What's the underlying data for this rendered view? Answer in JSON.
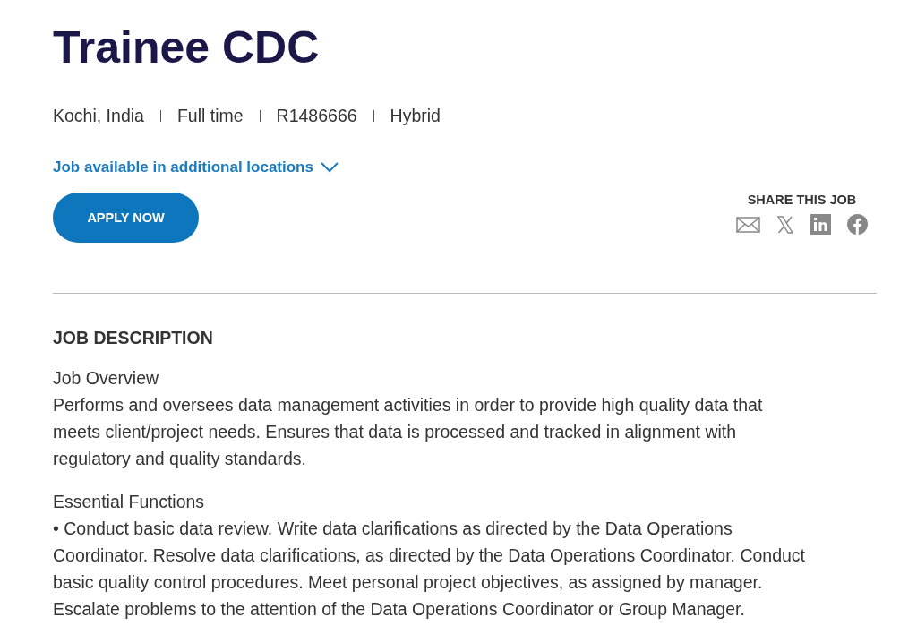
{
  "job": {
    "title": "Trainee CDC",
    "meta": [
      "Kochi, India",
      "Full time",
      "R1486666",
      "Hybrid"
    ],
    "locations_link": {
      "label": "Job available in additional locations",
      "expanded": false
    },
    "apply_button": "APPLY NOW",
    "share": {
      "heading": "SHARE THIS JOB",
      "icons": [
        {
          "kind": "email"
        },
        {
          "kind": "x"
        },
        {
          "kind": "linkedin"
        },
        {
          "kind": "facebook"
        }
      ]
    }
  },
  "description": {
    "heading": "JOB DESCRIPTION",
    "sections": [
      {
        "title": "Job Overview",
        "lines": [
          "Performs and oversees data management activities in order to provide high quality data that",
          "meets client/project needs. Ensures that data is processed and tracked in alignment with",
          "regulatory and quality standards."
        ]
      },
      {
        "title": "Essential Functions",
        "lines": [
          "• Conduct basic data review. Write data clarifications as directed by the Data Operations",
          "Coordinator. Resolve data clarifications, as directed by the Data Operations Coordinator. Conduct",
          "basic quality control procedures. Meet personal project objectives, as assigned by manager.",
          "Escalate problems to the attention of the Data Operations Coordinator or Group Manager."
        ]
      }
    ]
  }
}
